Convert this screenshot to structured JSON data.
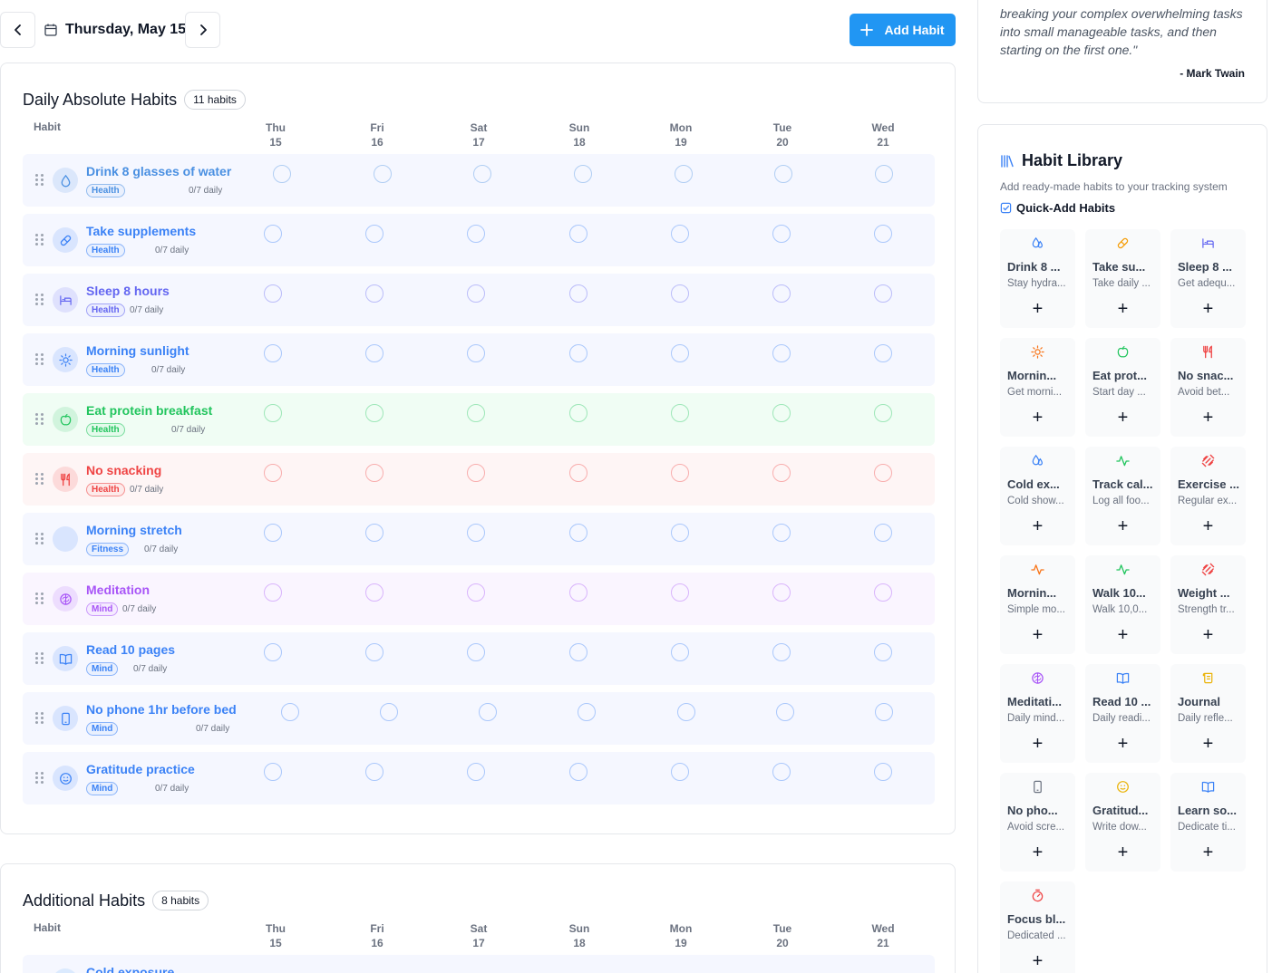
{
  "header": {
    "date": "Thursday, May 15",
    "add_habit_label": "Add Habit"
  },
  "days": [
    {
      "name": "Thu",
      "num": "15"
    },
    {
      "name": "Fri",
      "num": "16"
    },
    {
      "name": "Sat",
      "num": "17"
    },
    {
      "name": "Sun",
      "num": "18"
    },
    {
      "name": "Mon",
      "num": "19"
    },
    {
      "name": "Tue",
      "num": "20"
    },
    {
      "name": "Wed",
      "num": "21"
    }
  ],
  "daily": {
    "title": "Daily Absolute Habits",
    "count": "11 habits",
    "col_habit": "Habit",
    "habits": [
      {
        "name": "Drink 8 glasses of water",
        "tag": "Health",
        "progress": "0/7 daily",
        "color": "#4a90e2",
        "icon": "droplet-icon"
      },
      {
        "name": "Take supplements",
        "tag": "Health",
        "progress": "0/7 daily",
        "color": "#3b82f6",
        "icon": "pill-icon"
      },
      {
        "name": "Sleep 8 hours",
        "tag": "Health",
        "progress": "0/7 daily",
        "color": "#6366f1",
        "icon": "bed-icon"
      },
      {
        "name": "Morning sunlight",
        "tag": "Health",
        "progress": "0/7 daily",
        "color": "#3b82f6",
        "icon": "sun-icon"
      },
      {
        "name": "Eat protein breakfast",
        "tag": "Health",
        "progress": "0/7 daily",
        "color": "#22c55e",
        "icon": "apple-icon"
      },
      {
        "name": "No snacking",
        "tag": "Health",
        "progress": "0/7 daily",
        "color": "#ef4444",
        "icon": "utensils-icon"
      },
      {
        "name": "Morning stretch",
        "tag": "Fitness",
        "progress": "0/7 daily",
        "color": "#3b82f6",
        "icon": "stretch-icon"
      },
      {
        "name": "Meditation",
        "tag": "Mind",
        "progress": "0/7 daily",
        "color": "#a855f7",
        "icon": "brain-icon"
      },
      {
        "name": "Read 10 pages",
        "tag": "Mind",
        "progress": "0/7 daily",
        "color": "#3b82f6",
        "icon": "book-icon"
      },
      {
        "name": "No phone 1hr before bed",
        "tag": "Mind",
        "progress": "0/7 daily",
        "color": "#3b82f6",
        "icon": "phone-icon"
      },
      {
        "name": "Gratitude practice",
        "tag": "Mind",
        "progress": "0/7 daily",
        "color": "#3b82f6",
        "icon": "smile-icon"
      }
    ]
  },
  "additional": {
    "title": "Additional Habits",
    "count": "8 habits",
    "col_habit": "Habit",
    "first_habit": "Cold exposure"
  },
  "quote": {
    "text": "breaking your complex overwhelming tasks into small manageable tasks, and then starting on the first one.\"",
    "author": "- Mark Twain"
  },
  "library": {
    "title": "Habit Library",
    "subtitle": "Add ready-made habits to your tracking system",
    "quick_add": "Quick-Add Habits",
    "tiles": [
      {
        "name": "Drink 8 ...",
        "desc": "Stay hydra...",
        "icon": "droplets-icon",
        "color": "#3b82f6"
      },
      {
        "name": "Take su...",
        "desc": "Take daily ...",
        "icon": "pill-icon",
        "color": "#f59e0b"
      },
      {
        "name": "Sleep 8 ...",
        "desc": "Get adequ...",
        "icon": "bed-icon",
        "color": "#6366f1"
      },
      {
        "name": "Mornin...",
        "desc": "Get morni...",
        "icon": "sun-icon",
        "color": "#f97316"
      },
      {
        "name": "Eat prot...",
        "desc": "Start day ...",
        "icon": "apple-icon",
        "color": "#22c55e"
      },
      {
        "name": "No snac...",
        "desc": "Avoid bet...",
        "icon": "utensils-icon",
        "color": "#ef4444"
      },
      {
        "name": "Cold ex...",
        "desc": "Cold show...",
        "icon": "droplets-icon",
        "color": "#3b82f6"
      },
      {
        "name": "Track cal...",
        "desc": "Log all foo...",
        "icon": "activity-icon",
        "color": "#22c55e"
      },
      {
        "name": "Exercise ...",
        "desc": "Regular ex...",
        "icon": "dumbbell-icon",
        "color": "#ef4444"
      },
      {
        "name": "Mornin...",
        "desc": "Simple mo...",
        "icon": "activity-icon",
        "color": "#f97316"
      },
      {
        "name": "Walk 10...",
        "desc": "Walk 10,0...",
        "icon": "activity-icon",
        "color": "#22c55e"
      },
      {
        "name": "Weight ...",
        "desc": "Strength tr...",
        "icon": "dumbbell-icon",
        "color": "#ef4444"
      },
      {
        "name": "Meditati...",
        "desc": "Daily mind...",
        "icon": "brain-icon",
        "color": "#a855f7"
      },
      {
        "name": "Read 10 ...",
        "desc": "Daily readi...",
        "icon": "book-icon",
        "color": "#3b82f6"
      },
      {
        "name": "Journal",
        "desc": "Daily refle...",
        "icon": "scroll-icon",
        "color": "#eab308"
      },
      {
        "name": "No pho...",
        "desc": "Avoid scre...",
        "icon": "phone-icon",
        "color": "#6b7280"
      },
      {
        "name": "Gratitud...",
        "desc": "Write dow...",
        "icon": "smile-icon",
        "color": "#eab308"
      },
      {
        "name": "Learn so...",
        "desc": "Dedicate ti...",
        "icon": "book-icon",
        "color": "#3b82f6"
      },
      {
        "name": "Focus bl...",
        "desc": "Dedicated ...",
        "icon": "timer-icon",
        "color": "#ef4444"
      }
    ],
    "add_symbol": "+"
  }
}
